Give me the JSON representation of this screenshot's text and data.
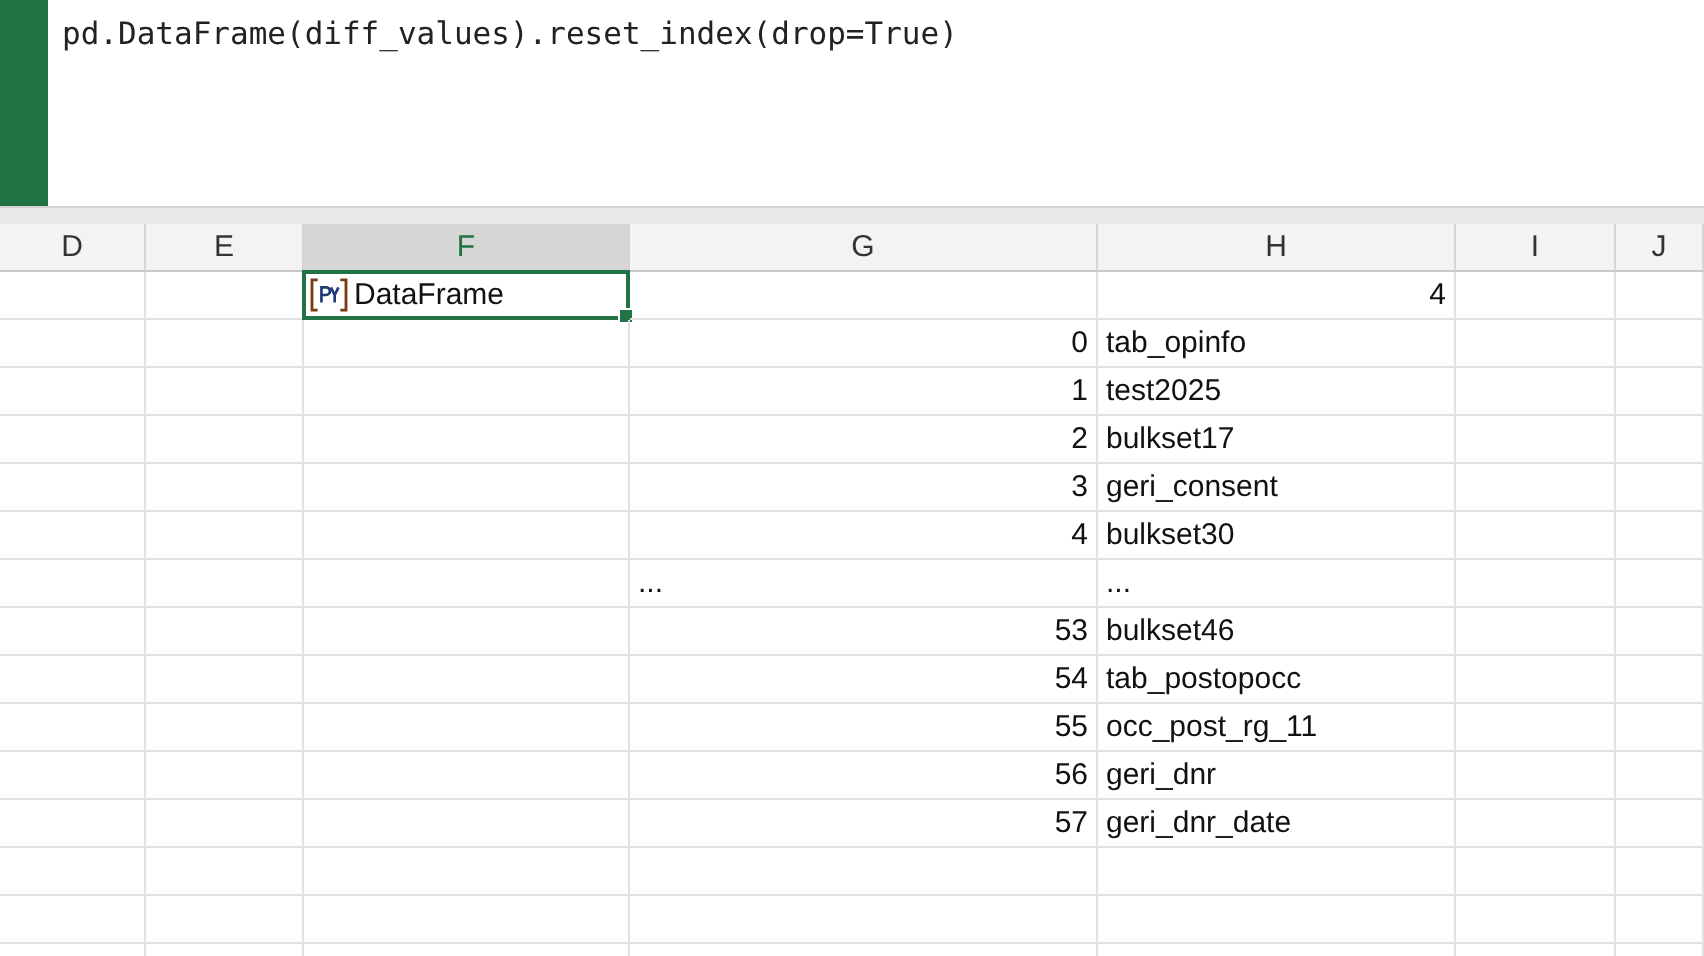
{
  "formula_bar": {
    "lines": [
      "pd.DataFrame(diff_values).reset_index(drop=True)"
    ]
  },
  "columns": [
    {
      "label": "D",
      "selected": false
    },
    {
      "label": "E",
      "selected": false
    },
    {
      "label": "F",
      "selected": true
    },
    {
      "label": "G",
      "selected": false
    },
    {
      "label": "H",
      "selected": false
    },
    {
      "label": "I",
      "selected": false
    },
    {
      "label": "J",
      "selected": false
    }
  ],
  "rows": [
    {
      "kind": "python",
      "f": "DataFrame",
      "h": "4"
    },
    {
      "kind": "value",
      "g": "0",
      "h": "tab_opinfo"
    },
    {
      "kind": "value",
      "g": "1",
      "h": "test2025"
    },
    {
      "kind": "value",
      "g": "2",
      "h": "bulkset17"
    },
    {
      "kind": "value",
      "g": "3",
      "h": "geri_consent"
    },
    {
      "kind": "value",
      "g": "4",
      "h": "bulkset30"
    },
    {
      "kind": "ellipsis",
      "g": "...",
      "h": "..."
    },
    {
      "kind": "value",
      "g": "53",
      "h": "bulkset46"
    },
    {
      "kind": "value",
      "g": "54",
      "h": "tab_postopocc"
    },
    {
      "kind": "value",
      "g": "55",
      "h": "occ_post_rg_11"
    },
    {
      "kind": "value",
      "g": "56",
      "h": "geri_dnr"
    },
    {
      "kind": "value",
      "g": "57",
      "h": "geri_dnr_date"
    }
  ]
}
